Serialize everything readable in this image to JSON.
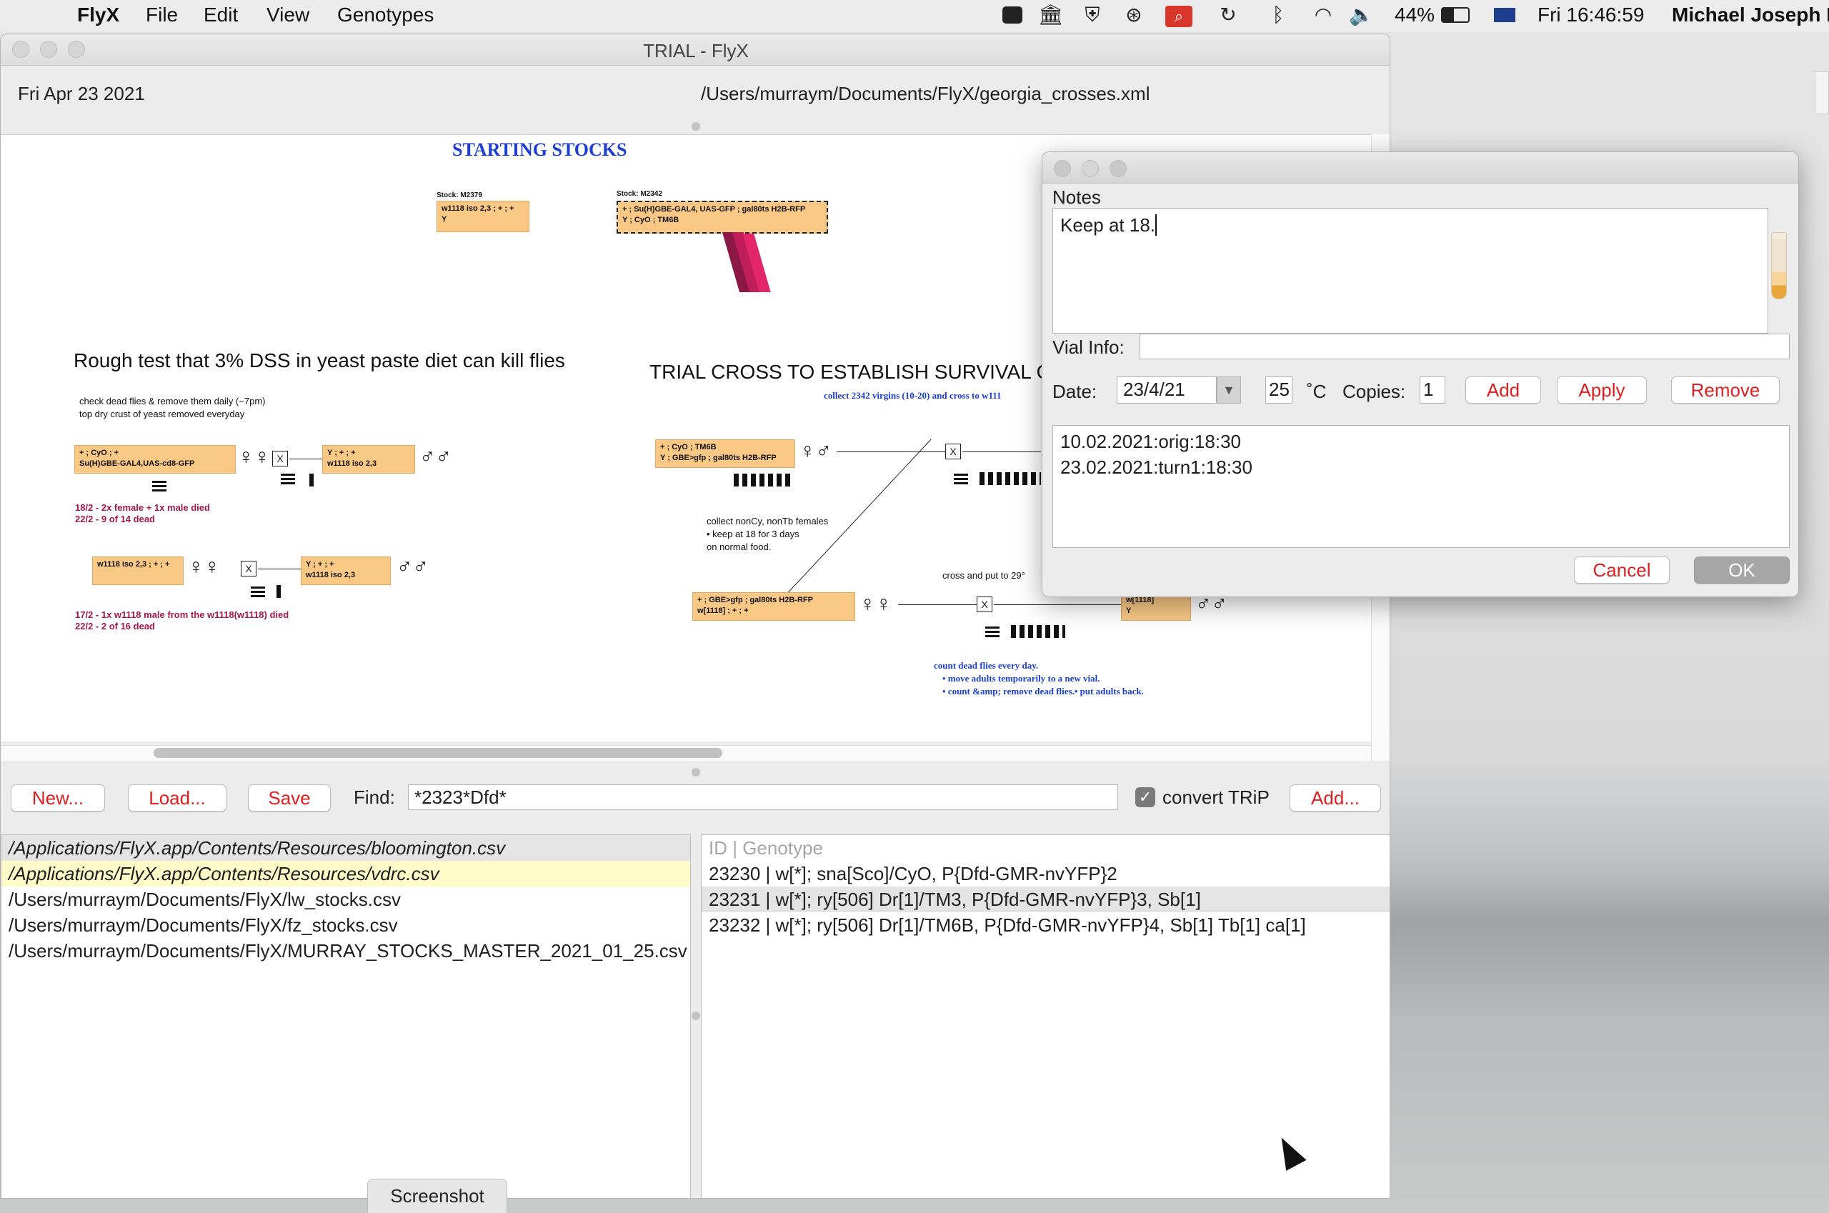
{
  "menubar": {
    "app": "FlyX",
    "menus": [
      "File",
      "Edit",
      "View",
      "Genotypes"
    ],
    "battery": "44%",
    "clock": "Fri 16:46:59",
    "user": "Michael Joseph M"
  },
  "window": {
    "title": "TRIAL - FlyX",
    "date": "Fri Apr 23 2021",
    "path": "/Users/murraym/Documents/FlyX/georgia_crosses.xml"
  },
  "canvas": {
    "starting_title": "STARTING STOCKS",
    "stock1": {
      "label": "Stock: M2379",
      "row1": "w1118 iso 2,3  ;  +  ;  +",
      "row2": "Y"
    },
    "stock2": {
      "label": "Stock: M2342",
      "row1": "+  ;  Su(H)GBE-GAL4, UAS-GFP  ;  gal80ts H2B-RFP",
      "row2": "Y  ;  CyO                                     ;  TM6B"
    },
    "rough_title": "Rough test that 3% DSS in yeast paste diet can kill flies",
    "rough_note1": "check dead flies & remove them daily (~7pm)",
    "rough_note2": "top dry crust of yeast removed everyday",
    "geno_a1": "+  ;  CyO                          ;  +",
    "geno_a2": "     Su(H)GBE-GAL4,UAS-cd8-GFP",
    "geno_b1": "Y               ;  +  ;  +",
    "geno_b2": "w1118 iso 2,3",
    "geno_c1": "w1118 iso 2,3  ;  +  ;  +",
    "geno_d1": "Y               ;  +  ;  +",
    "geno_d2": "w1118 iso 2,3",
    "died1a": "18/2 -  2x female + 1x  male died",
    "died1b": "22/2 - 9 of 14 dead",
    "died2a": "17/2 - 1x w1118 male from the w1118(w1118) died",
    "died2b": "22/2 - 2 of 16 dead",
    "trial_title": "TRIAL CROSS TO ESTABLISH SURVIVAL C",
    "collect_note": "collect 2342 virgins (10-20)  and cross to w111",
    "geno_e1": "+  ;  CyO       ;  TM6B",
    "geno_e2": "Y  ;  GBE>gfp  ;  gal80ts H2B-RFP",
    "nonCy1": "collect nonCy, nonTb females",
    "nonCy2": "• keep at 18 for 3 days",
    "nonCy3": "  on normal food.",
    "cross29": "cross and put to 29°",
    "geno_f1": "+         ;  GBE>gfp  ;  gal80ts H2B-RFP",
    "geno_f2": "w[1118]  ;  +             ;  +",
    "geno_g1": "w[1118]",
    "geno_g2": "Y",
    "count1": "count dead flies every day.",
    "count2": "• move adults temporarily to a new vial.",
    "count3": "• count &amp; remove dead flies.• put adults back.",
    "female": "♀",
    "male": "♂",
    "cross_mark": "X"
  },
  "toolbar": {
    "new": "New...",
    "load": "Load...",
    "save": "Save",
    "find_label": "Find:",
    "find_value": "*2323*Dfd*",
    "convert_label": "convert TRiP",
    "convert_checked": true,
    "add": "Add..."
  },
  "files": [
    "/Applications/FlyX.app/Contents/Resources/bloomington.csv",
    "/Applications/FlyX.app/Contents/Resources/vdrc.csv",
    "/Users/murraym/Documents/FlyX/lw_stocks.csv",
    "/Users/murraym/Documents/FlyX/fz_stocks.csv",
    "/Users/murraym/Documents/FlyX/MURRAY_STOCKS_MASTER_2021_01_25.csv"
  ],
  "results": {
    "header": "ID     |    Genotype",
    "rows": [
      "23230   |   w[*]; sna[Sco]/CyO, P{Dfd-GMR-nvYFP}2",
      "23231   |   w[*]; ry[506] Dr[1]/TM3, P{Dfd-GMR-nvYFP}3, Sb[1]",
      "23232   |   w[*]; ry[506] Dr[1]/TM6B, P{Dfd-GMR-nvYFP}4, Sb[1] Tb[1] ca[1]"
    ]
  },
  "screenshot_tab": "Screenshot",
  "notes": {
    "title": "Notes",
    "text": "Keep at 18.",
    "vial_label": "Vial Info:",
    "vial_value": "",
    "date_label": "Date:",
    "date_value": "23/4/21",
    "temp": "25",
    "temp_unit": "˚C",
    "copies_label": "Copies:",
    "copies": "1",
    "add": "Add",
    "apply": "Apply",
    "remove": "Remove",
    "history": [
      "10.02.2021:orig:18:30",
      "23.02.2021:turn1:18:30"
    ],
    "cancel": "Cancel",
    "ok": "OK"
  },
  "colors": {
    "accent": "#e01f1f",
    "genotype_fill": "#f9c885",
    "annotation_blue": "#1c3fd2",
    "annotation_maroon": "#a5174b",
    "selection_yellow": "#fffbc9"
  }
}
